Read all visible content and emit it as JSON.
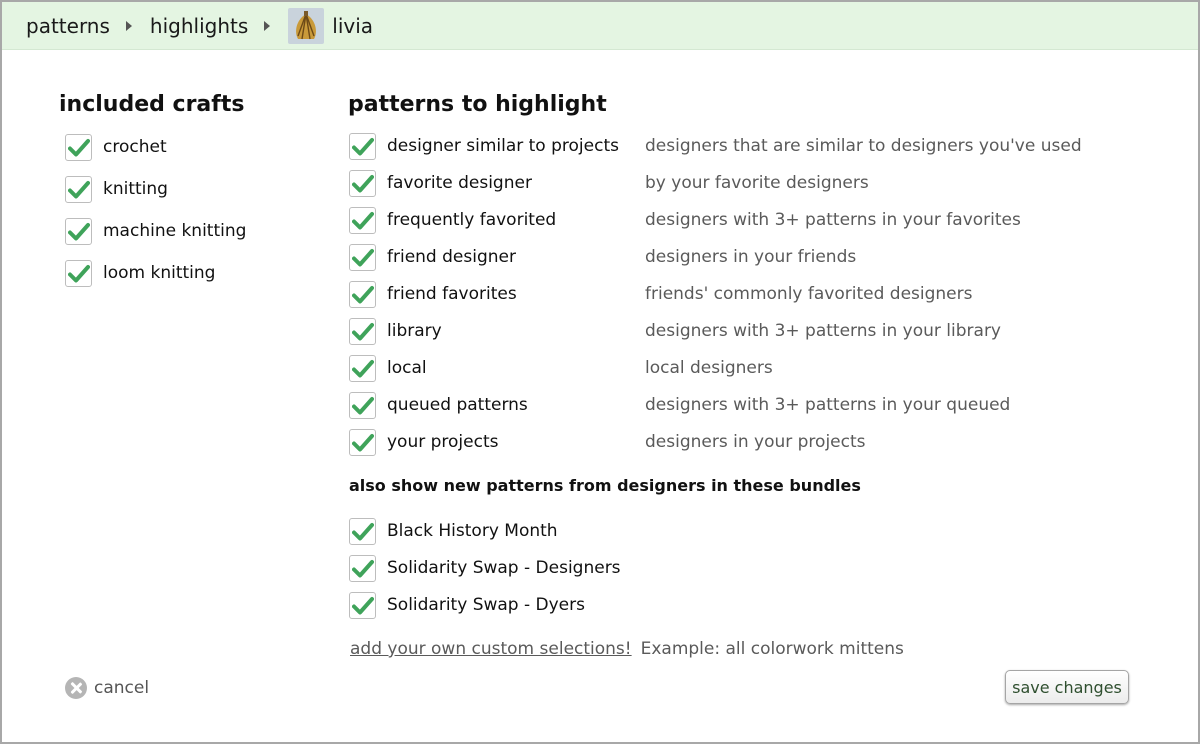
{
  "breadcrumb": {
    "items": [
      "patterns",
      "highlights"
    ],
    "user": "livia"
  },
  "crafts": {
    "title": "included crafts",
    "items": [
      {
        "label": "crochet",
        "checked": true
      },
      {
        "label": "knitting",
        "checked": true
      },
      {
        "label": "machine knitting",
        "checked": true
      },
      {
        "label": "loom knitting",
        "checked": true
      }
    ]
  },
  "patterns": {
    "title": "patterns to highlight",
    "items": [
      {
        "label": "designer similar to projects",
        "desc": "designers that are similar to designers you've used",
        "checked": true
      },
      {
        "label": "favorite designer",
        "desc": "by your favorite designers",
        "checked": true
      },
      {
        "label": "frequently favorited",
        "desc": "designers with 3+ patterns in your favorites",
        "checked": true
      },
      {
        "label": "friend designer",
        "desc": "designers in your friends",
        "checked": true
      },
      {
        "label": "friend favorites",
        "desc": "friends' commonly favorited designers",
        "checked": true
      },
      {
        "label": "library",
        "desc": "designers with 3+ patterns in your library",
        "checked": true
      },
      {
        "label": "local",
        "desc": "local designers",
        "checked": true
      },
      {
        "label": "queued patterns",
        "desc": "designers with 3+ patterns in your queued",
        "checked": true
      },
      {
        "label": "your projects",
        "desc": "designers in your projects",
        "checked": true
      }
    ]
  },
  "bundles": {
    "title": "also show new patterns from designers in these bundles",
    "items": [
      {
        "label": "Black History Month",
        "checked": true
      },
      {
        "label": "Solidarity Swap - Designers",
        "checked": true
      },
      {
        "label": "Solidarity Swap - Dyers",
        "checked": true
      }
    ]
  },
  "custom": {
    "link": "add your own custom selections!",
    "example": "Example: all colorwork mittens"
  },
  "actions": {
    "cancel": "cancel",
    "save": "save changes"
  },
  "colors": {
    "header_bg": "#e4f5e2",
    "check": "#3fa35a"
  }
}
